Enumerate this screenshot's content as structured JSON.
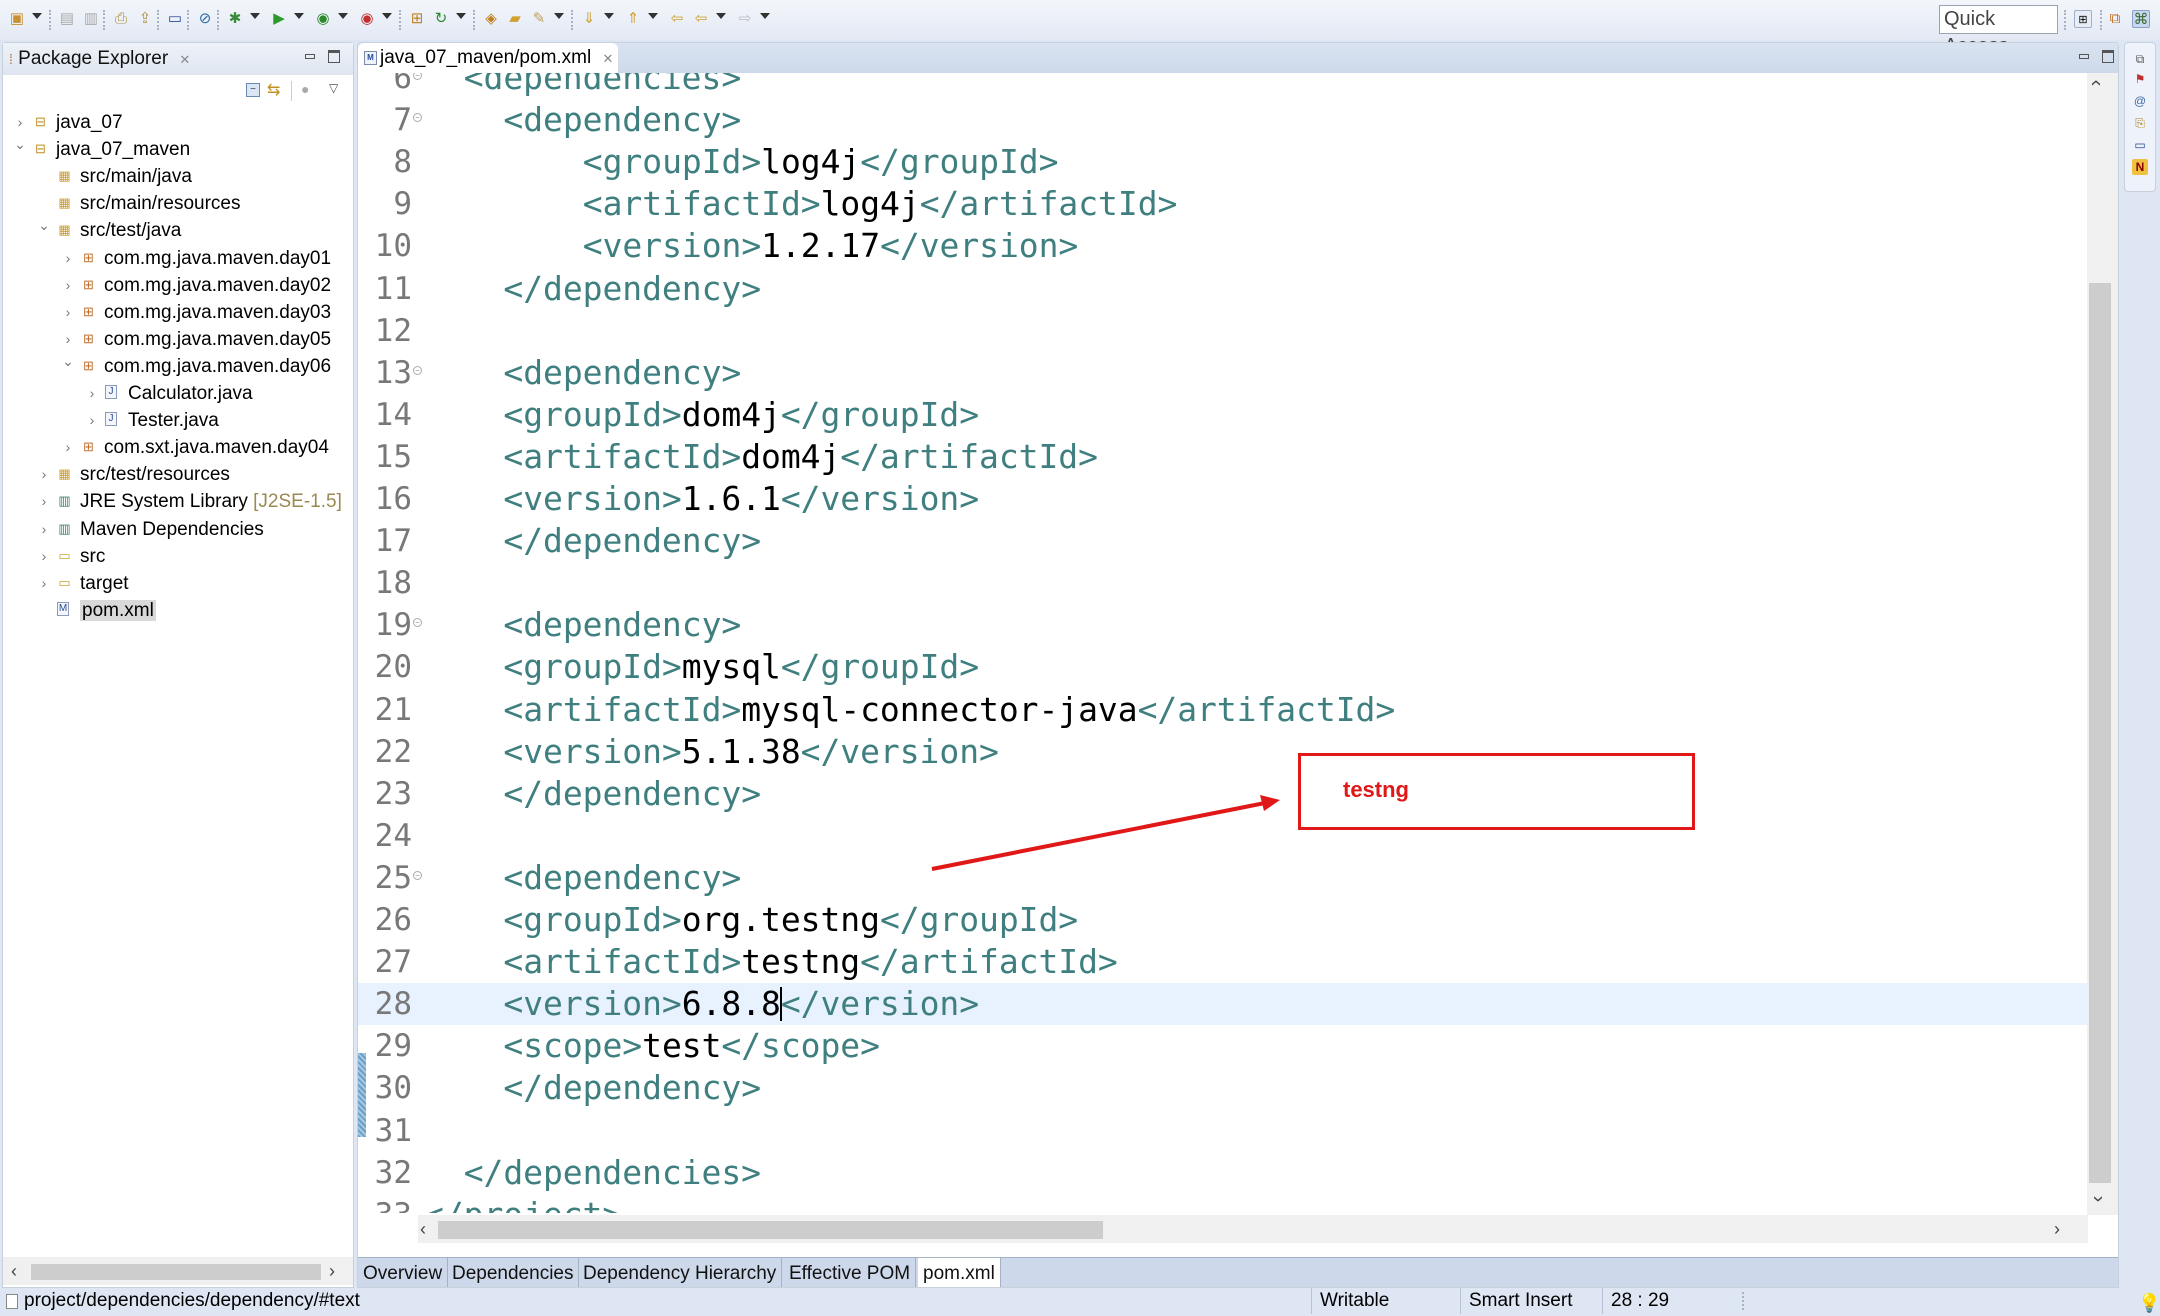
{
  "toolbar": {
    "quick_access": "Quick Access",
    "icons": [
      "new-icon",
      "save-icon",
      "save-all-icon",
      "print-icon",
      "publish-icon",
      "terminal-icon",
      "skip-breakpoints-icon",
      "debug-icon",
      "run-icon",
      "run-coverage-icon",
      "external-tools-icon",
      "new-package-icon",
      "refresh-icon",
      "open-type-icon",
      "open-folder-icon",
      "search-icon",
      "next-annotation-icon",
      "prev-annotation-icon",
      "last-edit-icon",
      "back-icon",
      "forward-icon"
    ]
  },
  "package_explorer": {
    "title": "Package Explorer",
    "tree": [
      {
        "label": "java_07",
        "depth": 0,
        "arrow": "collapsed",
        "icon": "project"
      },
      {
        "label": "java_07_maven",
        "depth": 0,
        "arrow": "expanded",
        "icon": "maven-project"
      },
      {
        "label": "src/main/java",
        "depth": 1,
        "arrow": "none",
        "icon": "source-folder"
      },
      {
        "label": "src/main/resources",
        "depth": 1,
        "arrow": "none",
        "icon": "source-folder"
      },
      {
        "label": "src/test/java",
        "depth": 1,
        "arrow": "expanded",
        "icon": "source-folder"
      },
      {
        "label": "com.mg.java.maven.day01",
        "depth": 2,
        "arrow": "collapsed",
        "icon": "package"
      },
      {
        "label": "com.mg.java.maven.day02",
        "depth": 2,
        "arrow": "collapsed",
        "icon": "package"
      },
      {
        "label": "com.mg.java.maven.day03",
        "depth": 2,
        "arrow": "collapsed",
        "icon": "package"
      },
      {
        "label": "com.mg.java.maven.day05",
        "depth": 2,
        "arrow": "collapsed",
        "icon": "package"
      },
      {
        "label": "com.mg.java.maven.day06",
        "depth": 2,
        "arrow": "expanded",
        "icon": "package"
      },
      {
        "label": "Calculator.java",
        "depth": 3,
        "arrow": "collapsed",
        "icon": "java-file"
      },
      {
        "label": "Tester.java",
        "depth": 3,
        "arrow": "collapsed",
        "icon": "java-file"
      },
      {
        "label": "com.sxt.java.maven.day04",
        "depth": 2,
        "arrow": "collapsed",
        "icon": "package"
      },
      {
        "label": "src/test/resources",
        "depth": 1,
        "arrow": "collapsed",
        "icon": "source-folder"
      },
      {
        "label": "JRE System Library",
        "decoration": "[J2SE-1.5]",
        "depth": 1,
        "arrow": "collapsed",
        "icon": "library"
      },
      {
        "label": "Maven Dependencies",
        "depth": 1,
        "arrow": "collapsed",
        "icon": "library"
      },
      {
        "label": "src",
        "depth": 1,
        "arrow": "collapsed",
        "icon": "folder"
      },
      {
        "label": "target",
        "depth": 1,
        "arrow": "collapsed",
        "icon": "folder"
      },
      {
        "label": "pom.xml",
        "depth": 1,
        "arrow": "none",
        "icon": "pom-file",
        "selected": true
      }
    ]
  },
  "editor": {
    "tab_title": "java_07_maven/pom.xml",
    "current_line": 28,
    "lines": [
      {
        "n": 6,
        "fold": true,
        "indent": 2,
        "parts": [
          [
            "tag",
            "<dependencies>"
          ]
        ]
      },
      {
        "n": 7,
        "fold": true,
        "indent": 4,
        "parts": [
          [
            "tag",
            "<dependency>"
          ]
        ]
      },
      {
        "n": 8,
        "indent": 8,
        "parts": [
          [
            "tag",
            "<groupId>"
          ],
          [
            "txt",
            "log4j"
          ],
          [
            "tag",
            "</groupId>"
          ]
        ]
      },
      {
        "n": 9,
        "indent": 8,
        "parts": [
          [
            "tag",
            "<artifactId>"
          ],
          [
            "txt",
            "log4j"
          ],
          [
            "tag",
            "</artifactId>"
          ]
        ]
      },
      {
        "n": 10,
        "indent": 8,
        "parts": [
          [
            "tag",
            "<version>"
          ],
          [
            "txt",
            "1.2.17"
          ],
          [
            "tag",
            "</version>"
          ]
        ]
      },
      {
        "n": 11,
        "indent": 4,
        "parts": [
          [
            "tag",
            "</dependency>"
          ]
        ]
      },
      {
        "n": 12,
        "indent": 0,
        "parts": []
      },
      {
        "n": 13,
        "fold": true,
        "indent": 4,
        "parts": [
          [
            "tag",
            "<dependency>"
          ]
        ]
      },
      {
        "n": 14,
        "indent": 4,
        "parts": [
          [
            "tag",
            "<groupId>"
          ],
          [
            "txt",
            "dom4j"
          ],
          [
            "tag",
            "</groupId>"
          ]
        ]
      },
      {
        "n": 15,
        "indent": 4,
        "parts": [
          [
            "tag",
            "<artifactId>"
          ],
          [
            "txt",
            "dom4j"
          ],
          [
            "tag",
            "</artifactId>"
          ]
        ]
      },
      {
        "n": 16,
        "indent": 4,
        "parts": [
          [
            "tag",
            "<version>"
          ],
          [
            "txt",
            "1.6.1"
          ],
          [
            "tag",
            "</version>"
          ]
        ]
      },
      {
        "n": 17,
        "indent": 4,
        "parts": [
          [
            "tag",
            "</dependency>"
          ]
        ]
      },
      {
        "n": 18,
        "indent": 0,
        "parts": []
      },
      {
        "n": 19,
        "fold": true,
        "indent": 4,
        "parts": [
          [
            "tag",
            "<dependency>"
          ]
        ]
      },
      {
        "n": 20,
        "indent": 4,
        "parts": [
          [
            "tag",
            "<groupId>"
          ],
          [
            "txt",
            "mysql"
          ],
          [
            "tag",
            "</groupId>"
          ]
        ]
      },
      {
        "n": 21,
        "indent": 4,
        "parts": [
          [
            "tag",
            "<artifactId>"
          ],
          [
            "txt",
            "mysql-connector-java"
          ],
          [
            "tag",
            "</artifactId>"
          ]
        ]
      },
      {
        "n": 22,
        "indent": 4,
        "parts": [
          [
            "tag",
            "<version>"
          ],
          [
            "txt",
            "5.1.38"
          ],
          [
            "tag",
            "</version>"
          ]
        ]
      },
      {
        "n": 23,
        "indent": 4,
        "parts": [
          [
            "tag",
            "</dependency>"
          ]
        ]
      },
      {
        "n": 24,
        "indent": 0,
        "parts": []
      },
      {
        "n": 25,
        "fold": true,
        "indent": 4,
        "parts": [
          [
            "tag",
            "<dependency>"
          ]
        ]
      },
      {
        "n": 26,
        "indent": 4,
        "parts": [
          [
            "tag",
            "<groupId>"
          ],
          [
            "txt",
            "org.testng"
          ],
          [
            "tag",
            "</groupId>"
          ]
        ]
      },
      {
        "n": 27,
        "indent": 4,
        "parts": [
          [
            "tag",
            "<artifactId>"
          ],
          [
            "txt",
            "testng"
          ],
          [
            "tag",
            "</artifactId>"
          ]
        ]
      },
      {
        "n": 28,
        "indent": 4,
        "parts": [
          [
            "tag",
            "<version>"
          ],
          [
            "txt",
            "6.8.8"
          ],
          [
            "caret",
            ""
          ],
          [
            "tag",
            "</version>"
          ]
        ]
      },
      {
        "n": 29,
        "indent": 4,
        "parts": [
          [
            "tag",
            "<scope>"
          ],
          [
            "txt",
            "test"
          ],
          [
            "tag",
            "</scope>"
          ]
        ]
      },
      {
        "n": 30,
        "indent": 4,
        "parts": [
          [
            "tag",
            "</dependency>"
          ]
        ]
      },
      {
        "n": 31,
        "indent": 0,
        "parts": []
      },
      {
        "n": 32,
        "indent": 2,
        "parts": [
          [
            "tag",
            "</dependencies>"
          ]
        ]
      },
      {
        "n": 33,
        "indent": 0,
        "parts": [
          [
            "tag",
            "</project>"
          ]
        ]
      }
    ],
    "bottom_tabs": [
      {
        "label": "Overview",
        "active": false
      },
      {
        "label": "Dependencies",
        "active": false
      },
      {
        "label": "Dependency Hierarchy",
        "active": false
      },
      {
        "label": "Effective POM",
        "active": false
      },
      {
        "label": "pom.xml",
        "active": true
      }
    ]
  },
  "annotation": {
    "label": "testng",
    "color": "#e01818"
  },
  "status_bar": {
    "path": "project/dependencies/dependency/#text",
    "writable": "Writable",
    "insert_mode": "Smart Insert",
    "position": "28 : 29"
  },
  "colors": {
    "tag": "#3f7f7f",
    "text": "#000000",
    "current_line": "#e8f2fe",
    "line_number": "#787878"
  }
}
